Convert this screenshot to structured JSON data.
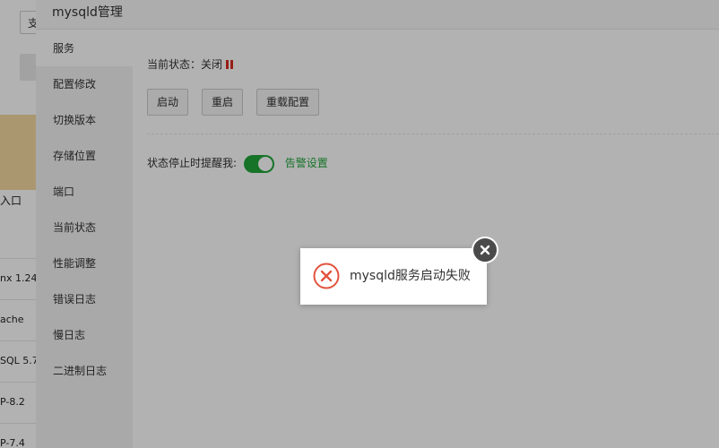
{
  "background": {
    "search_text": "支",
    "entry_text": "入口",
    "list": [
      "nx 1.24",
      "ache",
      "SQL 5.7",
      "P-8.2",
      "P-7.4"
    ]
  },
  "dialog": {
    "title": "mysqld管理",
    "menu": [
      "服务",
      "配置修改",
      "切换版本",
      "存储位置",
      "端口",
      "当前状态",
      "性能调整",
      "错误日志",
      "慢日志",
      "二进制日志"
    ],
    "active_menu": "服务",
    "status_label": "当前状态：",
    "status_value": "关闭",
    "buttons": [
      "启动",
      "重启",
      "重载配置"
    ],
    "alert_label": "状态停止时提醒我:",
    "alert_toggle_on": true,
    "alert_link": "告警设置"
  },
  "toast": {
    "message": "mysqld服务启动失败",
    "icon": "error-circle-icon",
    "close_icon": "close-icon"
  },
  "colors": {
    "accent": "#20a53a",
    "error": "#e2533e",
    "status_stop": "#d62d20"
  }
}
